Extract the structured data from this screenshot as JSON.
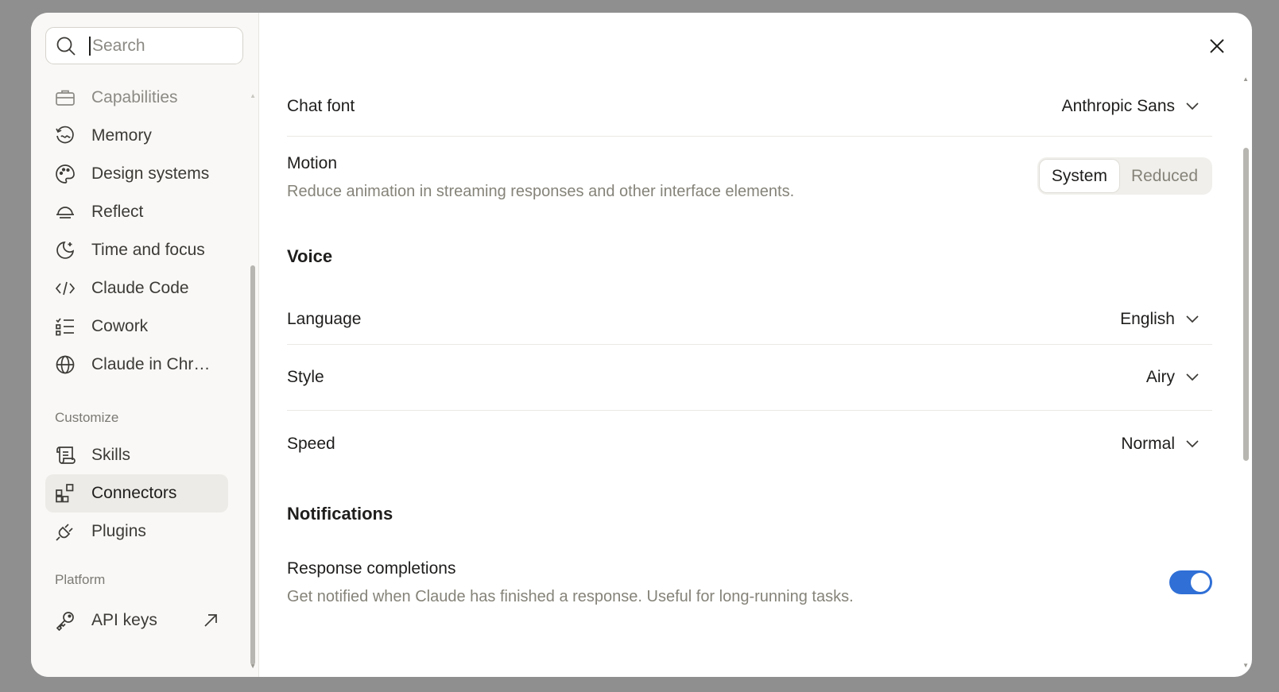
{
  "sidebar": {
    "search_placeholder": "Search",
    "items": [
      {
        "label": "Capabilities",
        "icon": "briefcase-icon"
      },
      {
        "label": "Memory",
        "icon": "memory-icon"
      },
      {
        "label": "Design systems",
        "icon": "palette-icon"
      },
      {
        "label": "Reflect",
        "icon": "sunset-icon"
      },
      {
        "label": "Time and focus",
        "icon": "moon-icon"
      },
      {
        "label": "Claude Code",
        "icon": "code-icon"
      },
      {
        "label": "Cowork",
        "icon": "checklist-icon"
      },
      {
        "label": "Claude in Chr…",
        "icon": "globe-icon"
      }
    ],
    "customize_label": "Customize",
    "customize_items": [
      {
        "label": "Skills",
        "icon": "scroll-icon"
      },
      {
        "label": "Connectors",
        "icon": "connectors-icon"
      },
      {
        "label": "Plugins",
        "icon": "plug-icon"
      }
    ],
    "platform_label": "Platform",
    "platform_items": [
      {
        "label": "API keys",
        "icon": "key-icon"
      }
    ]
  },
  "main": {
    "chat_font": {
      "label": "Chat font",
      "value": "Anthropic Sans"
    },
    "motion": {
      "label": "Motion",
      "description": "Reduce animation in streaming responses and other interface elements.",
      "options": [
        "System",
        "Reduced"
      ],
      "selected": "System"
    },
    "voice": {
      "heading": "Voice",
      "language": {
        "label": "Language",
        "value": "English"
      },
      "style": {
        "label": "Style",
        "value": "Airy"
      },
      "speed": {
        "label": "Speed",
        "value": "Normal"
      }
    },
    "notifications": {
      "heading": "Notifications",
      "response_completions": {
        "label": "Response completions",
        "description": "Get notified when Claude has finished a response. Useful for long-running tasks.",
        "enabled": true
      }
    }
  },
  "colors": {
    "toggle_on": "#2f6fd6",
    "overlay": "#8f8f8f"
  }
}
